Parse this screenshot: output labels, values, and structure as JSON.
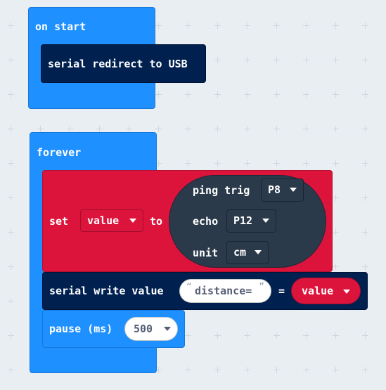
{
  "on_start": {
    "hat_label": "on start",
    "serial_redirect_label": "serial redirect to USB"
  },
  "forever": {
    "hat_label": "forever",
    "set_block": {
      "set_label": "set",
      "variable": "value",
      "to_label": "to",
      "ping": {
        "ping_label": "ping trig",
        "trig_pin": "P8",
        "echo_label": "echo",
        "echo_pin": "P12",
        "unit_label": "unit",
        "unit_value": "cm"
      }
    },
    "serial_write": {
      "label": "serial write value",
      "open_quote": "“",
      "name_text": "distance=",
      "close_quote": "”",
      "equals": "=",
      "value_var": "value"
    },
    "pause": {
      "label": "pause (ms)",
      "ms": "500"
    }
  },
  "colors": {
    "basic_blue": "#1e90ff",
    "serial_navy": "#002050",
    "variables_red": "#dc143c",
    "sonar_slate": "#2b3a4a",
    "workspace_bg": "#e9eef2"
  },
  "icons": {
    "dropdown": "chevron-down-icon"
  }
}
